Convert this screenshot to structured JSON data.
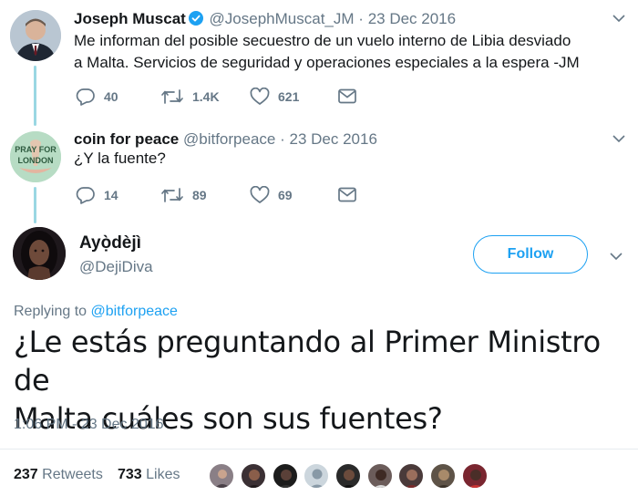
{
  "tweets": [
    {
      "name": "Joseph Muscat",
      "verified": true,
      "handle": "@JosephMuscat_JM",
      "separator": "·",
      "date": "23 Dec 2016",
      "text_line1": "Me informan del posible secuestro de un vuelo interno de Libia desviado",
      "text_line2": "a Malta. Servicios de seguridad y operaciones especiales a la espera -JM",
      "replies": "40",
      "retweets": "1.4K",
      "likes": "621"
    },
    {
      "name": "coin for peace",
      "handle": "@bitforpeace",
      "separator": "·",
      "date": "23 Dec 2016",
      "avatar_text_1": "PRAY FOR",
      "avatar_text_2": "LONDON",
      "text_line1": "¿Y la fuente?",
      "replies": "14",
      "retweets": "89",
      "likes": "69"
    }
  ],
  "main_tweet": {
    "name": "Ayọ̀dèjì",
    "handle": "@DejiDiva",
    "follow_label": "Follow",
    "replying_prefix": "Replying to",
    "replying_to": "@bitforpeace",
    "text_line1": "¿Le estás preguntando al Primer Ministro de",
    "text_line2": "Malta cuáles son sus fuentes?",
    "timestamp": "1:06 PM - 23 Dec 2016",
    "retweet_count": "237",
    "retweet_label": "Retweets",
    "like_count": "733",
    "like_label": "Likes"
  },
  "colors": {
    "accent": "#1da1f2",
    "muted": "#657786",
    "thread_line": "#9ad7e3"
  },
  "icons": [
    "verified-badge-icon",
    "reply-icon",
    "retweet-icon",
    "like-icon",
    "dm-icon",
    "chevron-down-icon"
  ]
}
